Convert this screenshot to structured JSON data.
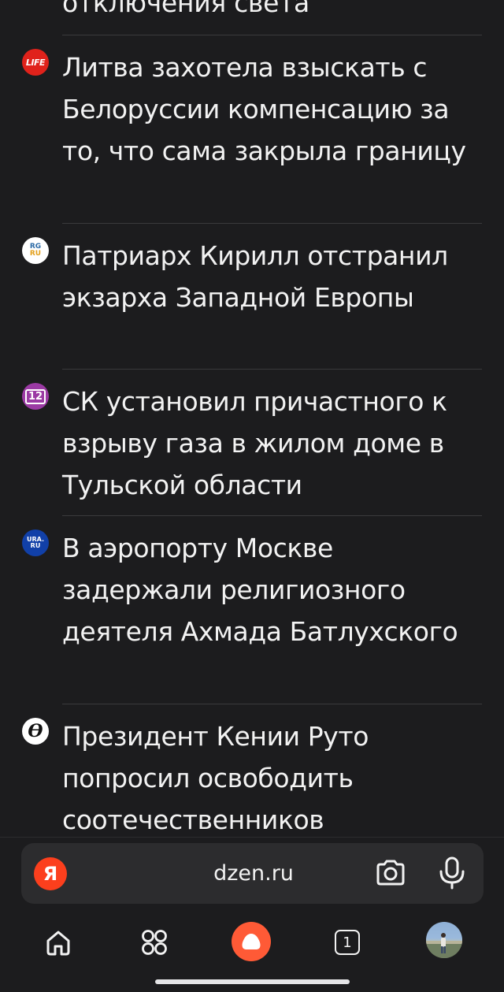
{
  "feed": {
    "partial_title": "отключения света",
    "items": [
      {
        "source": "LIFE",
        "title": "Литва захотела взыскать с Белоруссии компенсацию за то, что сама закрыла границу"
      },
      {
        "source_top": "RG",
        "source_bottom": "RU",
        "title": "Патриарх Кирилл отстранил экзарха Западной Европы"
      },
      {
        "source": "12",
        "title": "СК установил причастного к взрыву газа в жилом доме в Тульской области"
      },
      {
        "source_top": "URA.",
        "source_bottom": "RU",
        "title": "В аэропорту Москве задержали религиозного деятеля Ахмада Батлухского"
      },
      {
        "source": "Ө",
        "title": "Президент Кении Руто попросил освободить соотечественников"
      }
    ]
  },
  "address_bar": {
    "logo": "Я",
    "url": "dzen.ru",
    "icons": [
      "camera-search-icon",
      "microphone-icon"
    ]
  },
  "nav": {
    "tabs_count": "1",
    "icons": [
      "home-icon",
      "services-grid-icon",
      "alice-icon",
      "tabs-icon",
      "profile-avatar"
    ]
  },
  "colors": {
    "background": "#1c1c1e",
    "text": "#f2f2f2",
    "divider": "#3a3a3c",
    "yandex_red": "#fc3f1d",
    "alice_orange": "#ff5a36"
  }
}
